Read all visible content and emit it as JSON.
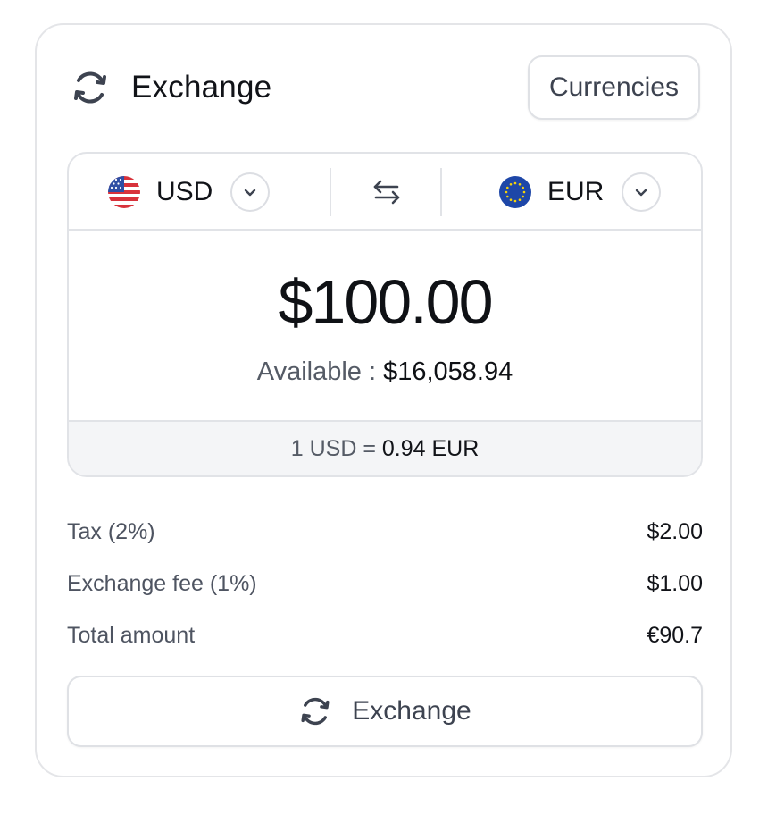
{
  "header": {
    "title": "Exchange",
    "icon": "refresh-icon",
    "currencies_button": "Currencies"
  },
  "selector": {
    "from": {
      "code": "USD",
      "flag": "us-flag-icon"
    },
    "to": {
      "code": "EUR",
      "flag": "eu-flag-icon"
    },
    "swap_icon": "swap-arrows-icon"
  },
  "amount": {
    "value": "$100.00",
    "available_label": "Available :",
    "available_value": "$16,058.94"
  },
  "rate": {
    "label": "1 USD =",
    "value": "0.94 EUR"
  },
  "summary": [
    {
      "label": "Tax (2%)",
      "value": "$2.00"
    },
    {
      "label": "Exchange fee (1%)",
      "value": "$1.00"
    },
    {
      "label": "Total amount",
      "value": "€90.7"
    }
  ],
  "action": {
    "label": "Exchange",
    "icon": "refresh-icon"
  },
  "colors": {
    "border": "#e4e5e8",
    "text_primary": "#0f1115",
    "text_secondary": "#555b66",
    "rate_bg": "#f4f5f7",
    "eu_blue": "#1e47a8",
    "eu_star": "#f5d20a",
    "us_red": "#d8323b",
    "us_blue": "#2f4fa5"
  }
}
